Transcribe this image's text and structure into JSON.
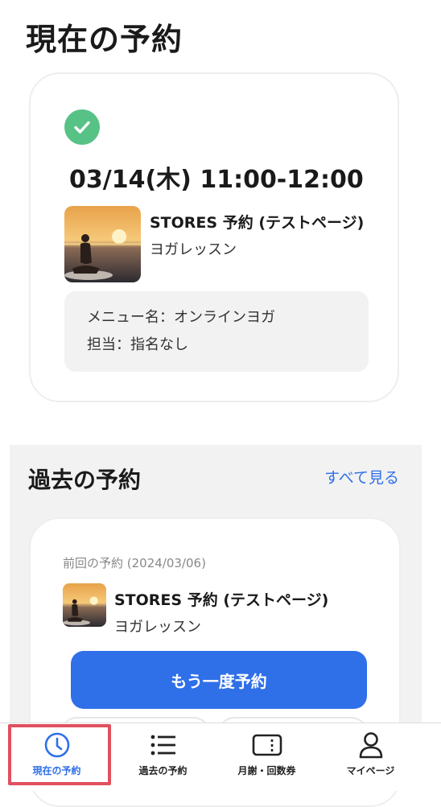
{
  "colors": {
    "accent": "#2f6fe8",
    "success": "#57c285",
    "highlight": "#e0505f"
  },
  "page_title": "現在の予約",
  "current": {
    "status_icon": "checkmark-circle-icon",
    "datetime": "03/14(木) 11:00-12:00",
    "store_name": "STORES 予約 (テストページ)",
    "subtitle": "ヨガレッスン",
    "menu_line": "メニュー名：オンラインヨガ",
    "staff_line": "担当：指名なし"
  },
  "past": {
    "title": "過去の予約",
    "see_all": "すべて見る",
    "last_label": "前回の予約 (2024/03/06)",
    "store_name": "STORES 予約 (テストページ)",
    "subtitle": "ヨガレッスン",
    "rebook_label": "もう一度予約"
  },
  "tabs": [
    {
      "label": "現在の予約",
      "icon": "clock-icon",
      "active": true
    },
    {
      "label": "過去の予約",
      "icon": "list-icon",
      "active": false
    },
    {
      "label": "月謝・回数券",
      "icon": "ticket-icon",
      "active": false
    },
    {
      "label": "マイページ",
      "icon": "person-icon",
      "active": false
    }
  ]
}
